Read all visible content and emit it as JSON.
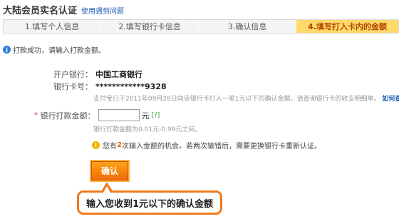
{
  "header": {
    "title": "大陆会员实名认证",
    "help_link": "使用遇到问题"
  },
  "steps": [
    {
      "label": "1.填写个人信息",
      "active": false
    },
    {
      "label": "2.填写银行卡信息",
      "active": false
    },
    {
      "label": "3.确认信息",
      "active": false
    },
    {
      "label": "4.填写打入卡内的金额",
      "active": true
    }
  ],
  "notice": {
    "icon": "info-icon",
    "text": "打款成功，请输入打款金额。"
  },
  "bank": {
    "label": "开户银行：",
    "value": "中国工商银行"
  },
  "card": {
    "label": "银行卡号：",
    "value": "************9328",
    "hint": "支付宝已于2011年09月28日向该银行卡打入一笔1元以下的确认金额，请查询银行卡的收支明细单。",
    "hint_link": "如何查看银"
  },
  "amount": {
    "required_mark": "*",
    "label": "银行打款金额：",
    "value": "",
    "unit": "元",
    "help": "[?]",
    "range_hint": "银行打款金额为0.01元-0.99元之间。"
  },
  "warning": {
    "icon": "warning-icon",
    "prefix": "您有",
    "count": "2",
    "suffix": "次输入金额的机会。若两次输错后，需要更换银行卡重新认证。"
  },
  "confirm_button": "确认",
  "callout": "输入您收到1元以下的确认金额",
  "colors": {
    "accent_orange": "#ef6b00",
    "active_step_bg": "#ffd96a",
    "link_blue": "#1e5fb4",
    "callout_border": "#f07b1d"
  }
}
